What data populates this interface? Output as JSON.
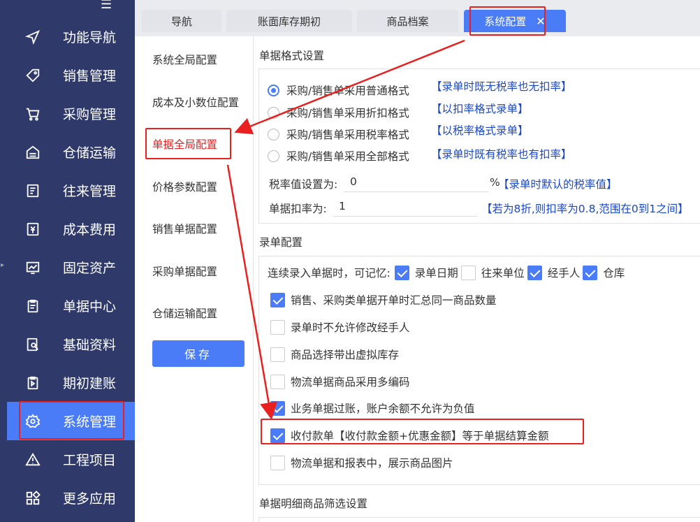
{
  "sidebar": {
    "menu_icon": "menu-icon",
    "items": [
      {
        "label": "功能导航",
        "icon": "navigation-icon"
      },
      {
        "label": "销售管理",
        "icon": "tag-icon"
      },
      {
        "label": "采购管理",
        "icon": "cart-icon"
      },
      {
        "label": "仓储运输",
        "icon": "warehouse-icon"
      },
      {
        "label": "往来管理",
        "icon": "contact-icon"
      },
      {
        "label": "成本费用",
        "icon": "cost-icon"
      },
      {
        "label": "固定资产",
        "icon": "asset-chart-icon"
      },
      {
        "label": "单据中心",
        "icon": "document-icon"
      },
      {
        "label": "基础资料",
        "icon": "data-icon"
      },
      {
        "label": "期初建账",
        "icon": "ledger-icon"
      },
      {
        "label": "系统管理",
        "icon": "gear-icon"
      },
      {
        "label": "工程项目",
        "icon": "warning-icon"
      },
      {
        "label": "更多应用",
        "icon": "apps-icon"
      }
    ],
    "active_index": 10
  },
  "tabs": [
    {
      "label": "导航"
    },
    {
      "label": "账面库存期初"
    },
    {
      "label": "商品档案"
    },
    {
      "label": "系统配置",
      "close": "✕"
    }
  ],
  "subnav": {
    "items": [
      "系统全局配置",
      "成本及小数位配置",
      "单据全局配置",
      "价格参数配置",
      "销售单据配置",
      "采购单据配置",
      "仓储运输配置"
    ],
    "active_index": 2,
    "save_label": "保存"
  },
  "format_section": {
    "title": "单据格式设置",
    "options": [
      {
        "label": "采购/销售单采用普通格式",
        "hint": "【录单时既无税率也无扣率】",
        "selected": true
      },
      {
        "label": "采购/销售单采用折扣格式",
        "hint": "【以扣率格式录单】",
        "selected": false
      },
      {
        "label": "采购/销售单采用税率格式",
        "hint": "【以税率格式录单】",
        "selected": false
      },
      {
        "label": "采购/销售单采用全部格式",
        "hint": "【录单时既有税率也有扣率】",
        "selected": false
      }
    ],
    "tax_label": "税率值设置为:",
    "tax_value": "0",
    "tax_unit": "%",
    "tax_hint": "【录单时默认的税率值】",
    "discount_label": "单据扣率为:",
    "discount_value": "1",
    "discount_hint": "【若为8折,则扣率为0.8,范围在0到1之间】"
  },
  "entry_section": {
    "title": "录单配置",
    "remember_label": "连续录入单据时，可记忆:",
    "remember_options": [
      {
        "label": "录单日期",
        "checked": true
      },
      {
        "label": "往来单位",
        "checked": false
      },
      {
        "label": "经手人",
        "checked": true
      },
      {
        "label": "仓库",
        "checked": true
      }
    ],
    "options": [
      {
        "label": "销售、采购类单据开单时汇总同一商品数量",
        "checked": true
      },
      {
        "label": "录单时不允许修改经手人",
        "checked": false
      },
      {
        "label": "商品选择带出虚拟库存",
        "checked": false
      },
      {
        "label": "物流单据商品采用多编码",
        "checked": false
      },
      {
        "label": "业务单据过账，账户余额不允许为负值",
        "checked": true
      },
      {
        "label": "收付款单【收付款金额+优惠金额】等于单据结算金额",
        "checked": true
      },
      {
        "label": "物流单据和报表中，展示商品图片",
        "checked": false
      }
    ]
  },
  "filter_section": {
    "title": "单据明细商品筛选设置"
  },
  "colors": {
    "sidebar_bg": "#2f3a6b",
    "accent": "#4a7cf7",
    "highlight_red": "#e8201f",
    "hint_blue": "#1a46c8"
  }
}
